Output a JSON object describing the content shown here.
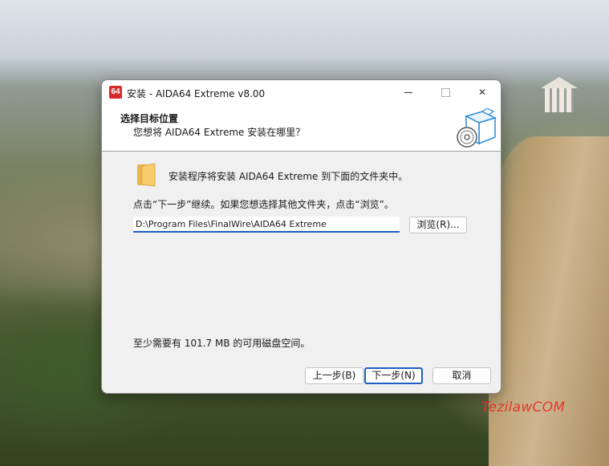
{
  "window": {
    "app_icon_text": "64",
    "title": "安装 - AIDA64 Extreme v8.00",
    "close_glyph": "✕"
  },
  "header": {
    "title": "选择目标位置",
    "subtitle": "您想将 AIDA64 Extreme 安装在哪里？",
    "icon": "install-box-icon"
  },
  "content": {
    "folder_icon": "folder-icon",
    "folder_text": "安装程序将安装 AIDA64 Extreme 到下面的文件夹中。",
    "instruction": "点击“下一步”继续。如果您想选择其他文件夹，点击“浏览”。",
    "path_value": "D:\\Program Files\\FinalWire\\AIDA64 Extreme",
    "browse_label": "浏览(R)...",
    "space_text": "至少需要有 101.7 MB 的可用磁盘空间。"
  },
  "buttons": {
    "back": "上一步(B)",
    "next": "下一步(N)",
    "cancel": "取消"
  },
  "watermark": "TezilawCOM",
  "colors": {
    "accent": "#1f5fbf",
    "app_icon": "#d92b2b",
    "watermark": "#e53a2f"
  }
}
